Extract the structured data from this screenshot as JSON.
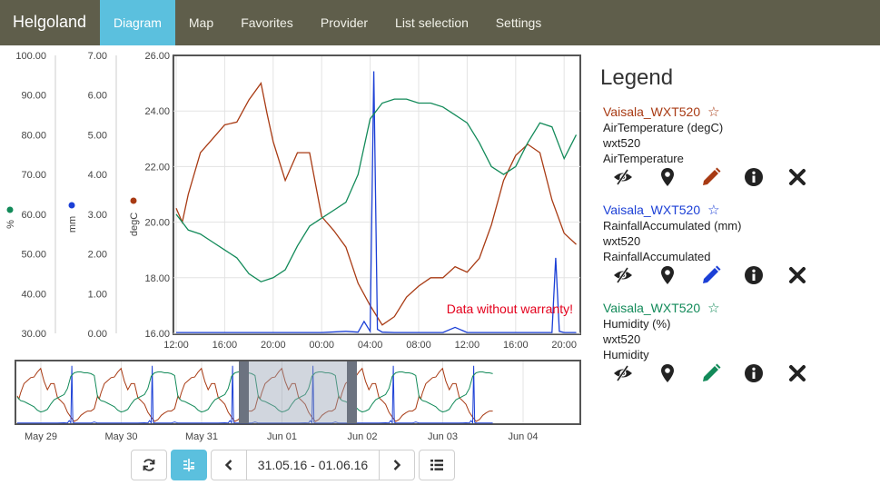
{
  "app": {
    "brand": "Helgoland",
    "nav": [
      {
        "label": "Diagram",
        "active": true
      },
      {
        "label": "Map",
        "active": false
      },
      {
        "label": "Favorites",
        "active": false
      },
      {
        "label": "Provider",
        "active": false
      },
      {
        "label": "List selection",
        "active": false
      },
      {
        "label": "Settings",
        "active": false
      }
    ]
  },
  "chart": {
    "warning": "Data without warranty!",
    "axes": [
      {
        "unit": "%",
        "color": "#128a59",
        "ticks": [
          "100.00",
          "90.00",
          "80.00",
          "70.00",
          "60.00",
          "50.00",
          "40.00",
          "30.00"
        ]
      },
      {
        "unit": "mm",
        "color": "#1b3fd6",
        "ticks": [
          "7.00",
          "6.00",
          "5.00",
          "4.00",
          "3.00",
          "2.00",
          "1.00",
          "0.00"
        ]
      },
      {
        "unit": "degC",
        "color": "#a83a13",
        "ticks": [
          "26.00",
          "24.00",
          "22.00",
          "20.00",
          "18.00",
          "16.00"
        ]
      }
    ],
    "x_ticks": [
      "12:00",
      "16:00",
      "20:00",
      "00:00",
      "04:00",
      "08:00",
      "12:00",
      "16:00",
      "20:00"
    ],
    "overview_ticks": [
      "May 29",
      "May 30",
      "May 31",
      "Jun 01",
      "Jun 02",
      "Jun 03",
      "Jun 04"
    ]
  },
  "chart_data": {
    "type": "line",
    "x_range": [
      "31.05.16 12:00",
      "01.06.16 21:00"
    ],
    "series": [
      {
        "name": "AirTemperature",
        "unit": "degC",
        "color": "#a83a13",
        "ylim": [
          16,
          26
        ],
        "t": [
          12,
          12.5,
          13,
          14,
          15,
          16,
          17,
          18,
          19,
          19.5,
          20,
          21,
          22,
          23,
          24,
          25,
          26,
          27,
          28,
          29,
          30,
          31,
          32,
          33,
          34,
          35,
          36,
          37,
          38,
          39,
          40,
          41,
          42,
          43,
          44,
          45
        ],
        "values": [
          20.5,
          20.0,
          21.0,
          22.5,
          23.0,
          23.5,
          23.6,
          24.4,
          25.0,
          23.9,
          22.9,
          21.5,
          22.5,
          22.5,
          20.2,
          19.7,
          19.1,
          17.8,
          17.0,
          16.3,
          16.6,
          17.3,
          17.7,
          18.0,
          18.0,
          18.4,
          18.2,
          18.7,
          19.9,
          21.5,
          22.4,
          22.8,
          22.5,
          20.8,
          19.6,
          19.2
        ]
      },
      {
        "name": "RainfallAccumulated",
        "unit": "mm",
        "color": "#1b3fd6",
        "ylim": [
          0,
          7
        ],
        "t": [
          12,
          16,
          20,
          24,
          26,
          27,
          27.5,
          28,
          28.3,
          28.6,
          29,
          30,
          31,
          34,
          35,
          36,
          40,
          43,
          43.3,
          43.6,
          44,
          45
        ],
        "values": [
          0.02,
          0.02,
          0.02,
          0.02,
          0.05,
          0.03,
          0.3,
          0.05,
          6.6,
          0.1,
          0.03,
          0.02,
          0.02,
          0.02,
          0.15,
          0.02,
          0.02,
          0.02,
          1.9,
          0.05,
          0.02,
          0.02
        ]
      },
      {
        "name": "Humidity",
        "unit": "%",
        "color": "#128a59",
        "ylim": [
          30,
          100
        ],
        "t": [
          12,
          13,
          14,
          15,
          16,
          17,
          18,
          19,
          20,
          21,
          22,
          23,
          24,
          25,
          26,
          27,
          28,
          29,
          30,
          31,
          32,
          33,
          34,
          35,
          36,
          37,
          38,
          39,
          40,
          41,
          42,
          43,
          44,
          45
        ],
        "values": [
          60,
          56,
          55,
          53,
          51,
          49,
          45,
          43,
          44,
          46,
          52,
          57,
          59,
          61,
          63,
          70,
          84,
          88,
          89,
          89,
          88,
          88,
          87,
          85,
          83,
          78,
          72,
          70,
          72,
          78,
          83,
          82,
          74,
          80
        ]
      }
    ]
  },
  "controls": {
    "date_range": "31.05.16 - 01.06.16"
  },
  "legend": {
    "title": "Legend",
    "entries": [
      {
        "name": "Vaisala_WXT520",
        "color": "#a83a13",
        "phenomenon": "AirTemperature (degC)",
        "procedure": "wxt520",
        "feature": "AirTemperature"
      },
      {
        "name": "Vaisala_WXT520",
        "color": "#1b3fd6",
        "phenomenon": "RainfallAccumulated (mm)",
        "procedure": "wxt520",
        "feature": "RainfallAccumulated"
      },
      {
        "name": "Vaisala_WXT520",
        "color": "#128a59",
        "phenomenon": "Humidity (%)",
        "procedure": "wxt520",
        "feature": "Humidity"
      }
    ]
  }
}
